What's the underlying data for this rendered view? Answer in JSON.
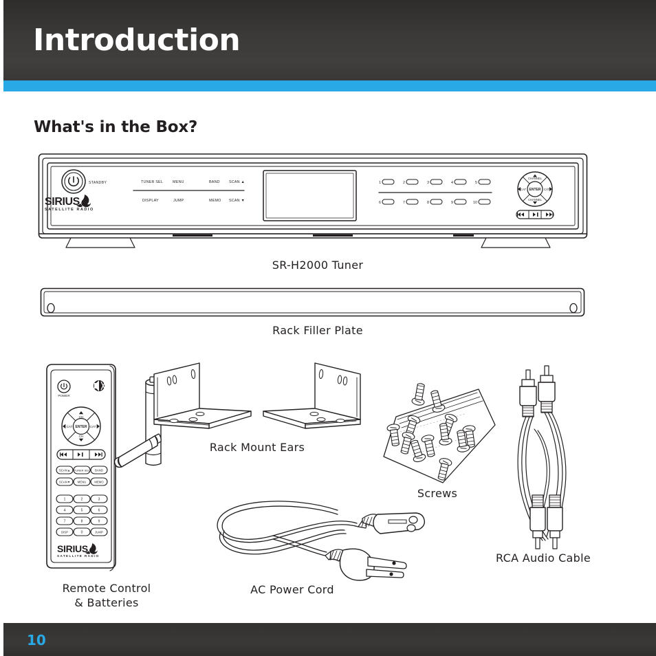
{
  "header": {
    "title": "Introduction",
    "accent_color": "#29a9e6",
    "background_color": "#3a3937"
  },
  "section": {
    "heading": "What's in the Box?"
  },
  "footer": {
    "page_number": "10",
    "page_number_color": "#29a9e6"
  },
  "figures": [
    {
      "id": "tuner",
      "caption": "SR-H2000 Tuner",
      "brand": "SIRIUS",
      "brand_sub": "SATELLITE RADIO",
      "standby_label": "STANDBY",
      "function_labels_top": [
        "TUNER SEL",
        "MENU",
        "BAND",
        "SCAN ▲"
      ],
      "function_labels_bottom": [
        "DISPLAY",
        "JUMP",
        "MEMO",
        "SCAN ▼"
      ],
      "preset_labels_top": [
        "1",
        "2",
        "3",
        "4",
        "5"
      ],
      "preset_labels_bottom": [
        "6",
        "7",
        "8",
        "9",
        "10"
      ],
      "navpad": {
        "up": "CHANNEL",
        "down": "CHANNEL",
        "left": "CAT",
        "right": "CAT",
        "center": "ENTER"
      },
      "transport": [
        "⏮",
        "⏯",
        "⏭"
      ]
    },
    {
      "id": "rack-filler-plate",
      "caption": "Rack Filler Plate"
    },
    {
      "id": "remote",
      "caption": "Remote Control\n& Batteries",
      "power_label": "POWER",
      "brand": "SIRIUS",
      "brand_sub": "SATELLITE RADIO",
      "navpad": {
        "up": "CH",
        "down": "CH",
        "left": "CAT",
        "right": "CAT",
        "center": "ENTER"
      },
      "transport": [
        "⏮",
        "⏯",
        "⏭"
      ],
      "function_row_1": [
        "SCAN ▲",
        "TUNER SEL",
        "BAND"
      ],
      "function_row_2": [
        "SCAN ▼",
        "MENU",
        "MEMO"
      ],
      "keypad": [
        "1",
        "2",
        "3",
        "4",
        "5",
        "6",
        "7",
        "8",
        "9",
        "DISP",
        "0",
        "JUMP"
      ],
      "battery_count": 2
    },
    {
      "id": "rack-mount-ears",
      "caption": "Rack Mount Ears"
    },
    {
      "id": "screws",
      "caption": "Screws",
      "screw_count": 12
    },
    {
      "id": "ac-power-cord",
      "caption": "AC Power Cord"
    },
    {
      "id": "rca-audio-cable",
      "caption": "RCA Audio Cable"
    }
  ]
}
